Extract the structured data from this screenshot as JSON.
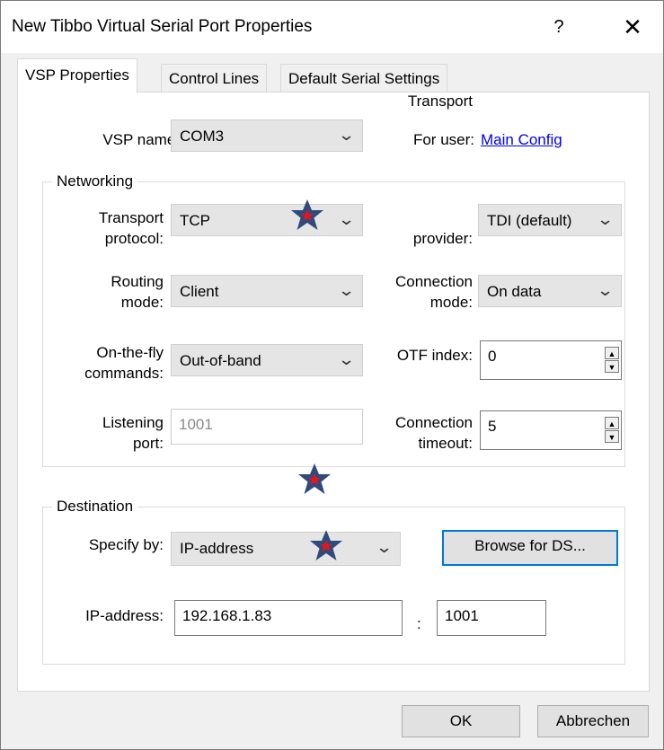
{
  "window": {
    "title": "New Tibbo Virtual Serial Port Properties",
    "help_label": "?",
    "close_label": "✕"
  },
  "tabs": [
    {
      "label": "VSP Properties",
      "active": true
    },
    {
      "label": "Control Lines",
      "active": false
    },
    {
      "label": "Default Serial Settings",
      "active": false
    }
  ],
  "vsp": {
    "name_label": "VSP name:",
    "name_value": "COM3",
    "user_label": "For user:",
    "user_link": "Main Config"
  },
  "networking": {
    "title": "Networking",
    "transport_protocol": {
      "label1": "Transport",
      "label2": "protocol:",
      "value": "TCP"
    },
    "transport_provider": {
      "label1": "Transport",
      "label2": "provider:",
      "value": "TDI (default)"
    },
    "routing_mode": {
      "label1": "Routing",
      "label2": "mode:",
      "value": "Client"
    },
    "connection_mode": {
      "label1": "Connection",
      "label2": "mode:",
      "value": "On data"
    },
    "otf_commands": {
      "label1": "On-the-fly",
      "label2": "commands:",
      "value": "Out-of-band"
    },
    "otf_index": {
      "label": "OTF index:",
      "value": "0"
    },
    "listening_port": {
      "label1": "Listening",
      "label2": "port:",
      "value": "1001"
    },
    "connection_timeout": {
      "label1": "Connection",
      "label2": "timeout:",
      "value": "5"
    }
  },
  "destination": {
    "title": "Destination",
    "specify_by": {
      "label": "Specify by:",
      "value": "IP-address"
    },
    "browse_label": "Browse for DS...",
    "ip": {
      "label": "IP-address:",
      "value": "192.168.1.83",
      "separator": ":",
      "port": "1001"
    }
  },
  "footer": {
    "ok_label": "OK",
    "cancel_label": "Abbrechen"
  },
  "colors": {
    "accent": "#0078d7",
    "star_fill": "#2f4b7c",
    "star_center": "#e8141b"
  },
  "icons": {
    "dropdown": "chevron-down-icon",
    "spin_up": "spin-up-icon",
    "spin_down": "spin-down-icon",
    "marker": "star-icon"
  }
}
